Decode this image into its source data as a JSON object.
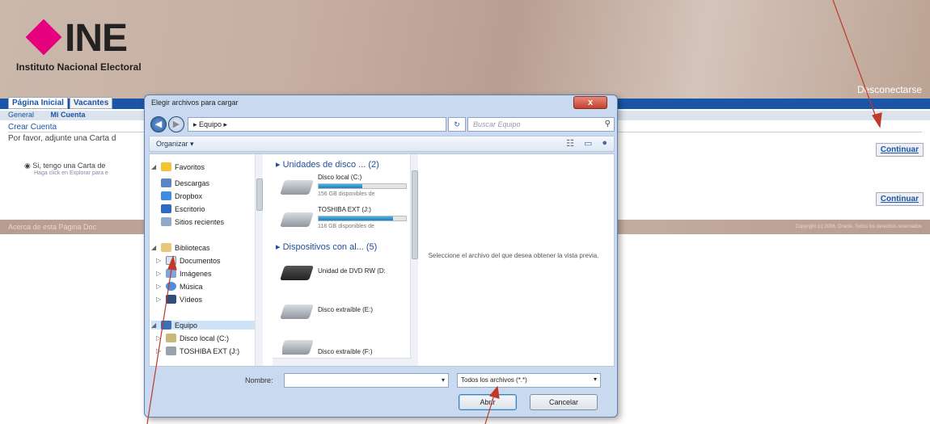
{
  "header": {
    "logo_text": "INE",
    "logo_sub": "Instituto Nacional Electoral",
    "logout": "Desconectarse"
  },
  "tabs": [
    "Página Inicial",
    "Vacantes"
  ],
  "subnav": {
    "general": "General",
    "sep": "|",
    "account": "Mi Cuenta"
  },
  "content": {
    "title": "Crear Cuenta",
    "text": "Por favor, adjunte una Carta d",
    "option": "Si, tengo una Carta de",
    "option_hint": "Haga click en Explorar para e",
    "continue_label": "Continuar"
  },
  "footer": {
    "left": "Acerca de esta Página   Doc",
    "right": "Copyright (c) 2006, Oracle. Todos los derechos reservados"
  },
  "dialog": {
    "title": "Elegir archivos para cargar",
    "close": "x",
    "breadcrumb": "▸  Equipo  ▸",
    "search_placeholder": "Buscar Equipo",
    "organize": "Organizar ▾",
    "nav": {
      "favorites": "Favoritos",
      "downloads": "Descargas",
      "dropbox": "Dropbox",
      "desktop": "Escritorio",
      "recent": "Sitios recientes",
      "libraries": "Bibliotecas",
      "documents": "Documentos",
      "images": "Imágenes",
      "music": "Música",
      "videos": "Vídeos",
      "computer": "Equipo",
      "local_disk": "Disco local (C:)",
      "toshiba": "TOSHIBA EXT (J:)"
    },
    "groups": {
      "disks": "Unidades de disco ... (2)",
      "devices": "Dispositivos con al... (5)"
    },
    "drives": [
      {
        "name": "Disco local (C:)",
        "free": "156 GB disponibles de",
        "used": 0.5
      },
      {
        "name": "TOSHIBA EXT (J:)",
        "free": "118 GB disponibles de",
        "used": 0.85
      }
    ],
    "devices": [
      "Unidad de DVD RW (D:",
      "Disco extraíble (E:)",
      "Disco extraíble (F:)"
    ],
    "preview_text": "Seleccione el archivo del que desea obtener la vista previa.",
    "name_label": "Nombre:",
    "name_value": "",
    "filter": "Todos los archivos (*.*)",
    "open": "Abrir",
    "cancel": "Cancelar"
  }
}
